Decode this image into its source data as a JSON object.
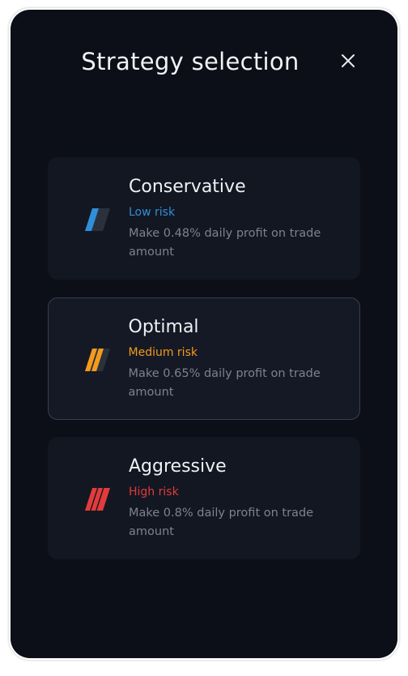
{
  "dialog": {
    "title": "Strategy selection"
  },
  "colors": {
    "background": "#0c0f17",
    "card": "#131722",
    "low": "#2f8fd8",
    "medium": "#f59a1b",
    "high": "#e23b3b"
  },
  "strategies": [
    {
      "name": "Conservative",
      "risk": "Low risk",
      "description": "Make 0.48% daily profit on trade amount",
      "icon": "risk-low-icon"
    },
    {
      "name": "Optimal",
      "risk": "Medium risk",
      "description": "Make 0.65% daily profit on trade amount",
      "icon": "risk-medium-icon"
    },
    {
      "name": "Aggressive",
      "risk": "High risk",
      "description": "Make 0.8% daily profit on trade amount",
      "icon": "risk-high-icon"
    }
  ]
}
